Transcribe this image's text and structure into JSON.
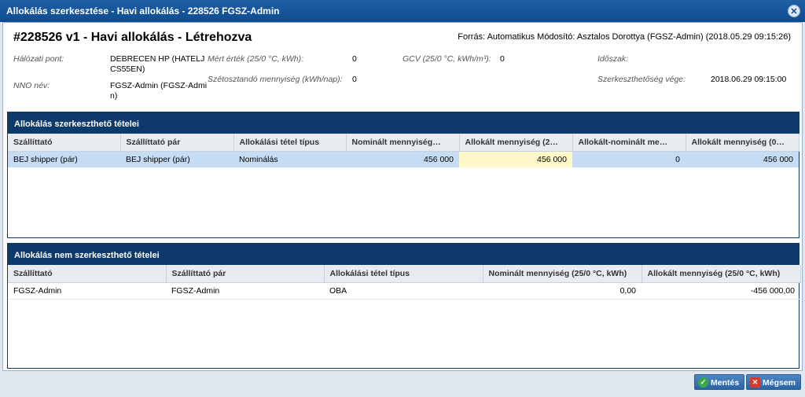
{
  "window": {
    "title": "Allokálás szerkesztése - Havi allokálás - 228526 FGSZ-Admin"
  },
  "header": {
    "title": "#228526 v1 - Havi allokálás - Létrehozva",
    "source": "Forrás: Automatikus Módosító: Asztalos Dorottya (FGSZ-Admin) (2018.05.29 09:15:26)"
  },
  "info": {
    "network_point_label": "Hálózati pont:",
    "network_point_value_1": "DEBRECEN HP (HATELJ",
    "network_point_value_2": "CS55EN)",
    "nno_label": "NNO név:",
    "nno_value_1": "FGSZ-Admin (FGSZ-Admi",
    "nno_value_2": "n)",
    "measured_label": "Mért érték (25/0 °C, kWh):",
    "measured_value": "0",
    "distributable_label": "Szétosztandó mennyiség (kWh/nap):",
    "distributable_value": "0",
    "gcv_label": "GCV (25/0 °C, kWh/m³):",
    "gcv_value": "0",
    "period_label": "Időszak:",
    "period_value": "",
    "edit_end_label": "Szerkeszthetőség vége:",
    "edit_end_value": "2018.06.29 09:15:00"
  },
  "editable_panel": {
    "title": "Allokálás szerkeszthető tételei",
    "columns": [
      "Szállíttató",
      "Szállíttató pár",
      "Allokálási tétel típus",
      "Nominált mennyiség…",
      "Allokált mennyiség (2…",
      "Allokált-nominált me…",
      "Allokált mennyiség (0…"
    ],
    "rows": [
      [
        "BEJ shipper (pár)",
        "BEJ shipper (pár)",
        "Nominálás",
        "456 000",
        "456 000",
        "0",
        "456 000"
      ]
    ]
  },
  "noneditable_panel": {
    "title": "Allokálás nem szerkeszthető tételei",
    "columns": [
      "Szállíttató",
      "Szállíttató pár",
      "Allokálási tétel típus",
      "Nominált mennyiség (25/0 °C, kWh)",
      "Allokált mennyiség (25/0 °C, kWh)"
    ],
    "rows": [
      [
        "FGSZ-Admin",
        "FGSZ-Admin",
        "OBA",
        "0,00",
        "-456 000,00"
      ]
    ]
  },
  "footer": {
    "save_label": "Mentés",
    "cancel_label": "Mégsem"
  },
  "icons": {
    "close": "close-icon",
    "save": "check-icon",
    "cancel": "x-icon"
  },
  "colors": {
    "titlebar": "#0f4c8f",
    "panel_header": "#0d3a6a",
    "selected_row": "#c6dcf3",
    "editable_cell": "#fff8c8"
  }
}
